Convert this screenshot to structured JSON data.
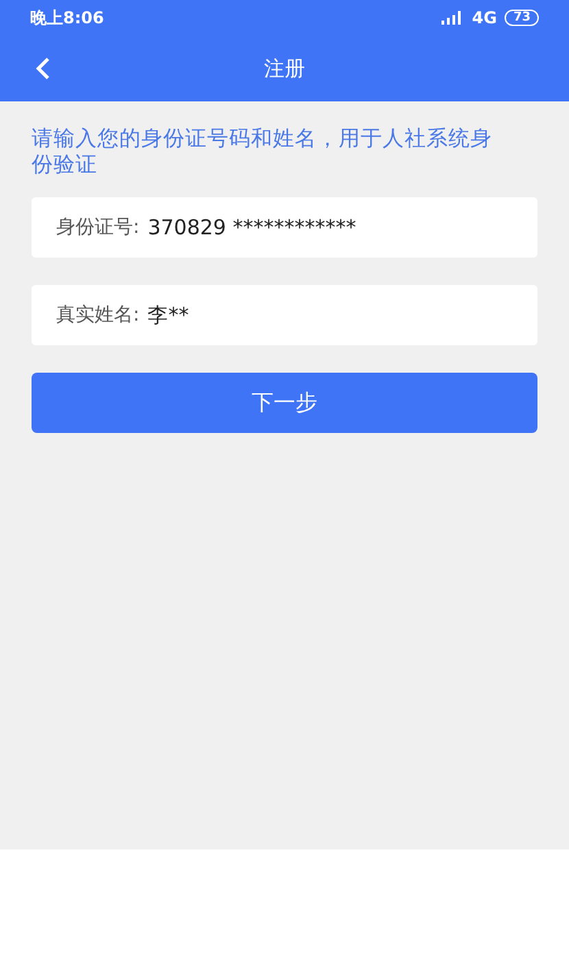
{
  "status_bar": {
    "time": "晚上8:06",
    "network": "4G",
    "battery": "73"
  },
  "header": {
    "title": "注册"
  },
  "hint": "请输入您的身份证号码和姓名，用于人社系统身份验证",
  "fields": [
    {
      "label": "身份证号:",
      "value": "370829 ************"
    },
    {
      "label": "真实姓名:",
      "value": "李**"
    }
  ],
  "button": "下一步"
}
